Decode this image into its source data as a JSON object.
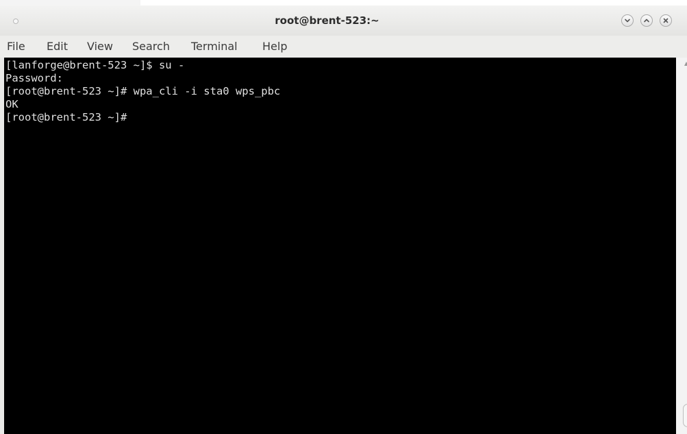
{
  "window": {
    "title": "root@brent-523:~"
  },
  "menubar": {
    "items": [
      "File",
      "Edit",
      "View",
      "Search",
      "Terminal",
      "Help"
    ]
  },
  "terminal": {
    "lines": [
      "[lanforge@brent-523 ~]$ su -",
      "Password:",
      "[root@brent-523 ~]# wpa_cli -i sta0 wps_pbc",
      "OK",
      "[root@brent-523 ~]# "
    ]
  },
  "icons": {
    "minimize": "chevron-down-icon",
    "maximize": "chevron-up-icon",
    "close": "close-icon"
  }
}
